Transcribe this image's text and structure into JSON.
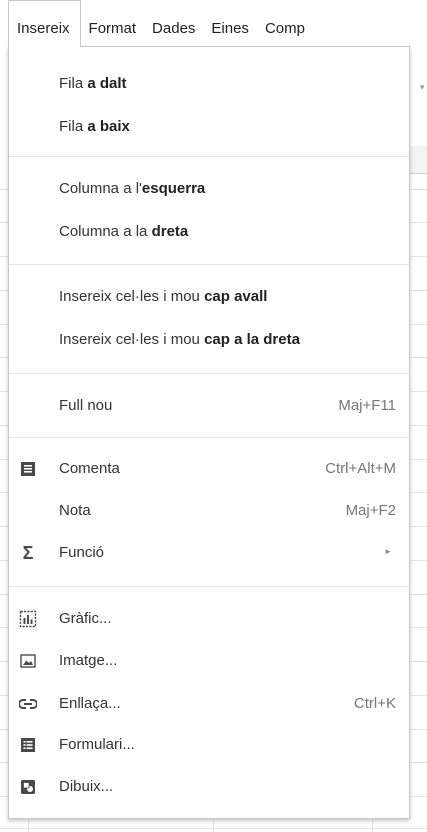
{
  "menubar": {
    "items": [
      {
        "label": "Insereix"
      },
      {
        "label": "Format"
      },
      {
        "label": "Dades"
      },
      {
        "label": "Eines"
      },
      {
        "label": "Comp"
      }
    ]
  },
  "dropdown": {
    "row_above": {
      "pre": "Fila ",
      "bold": "a dalt"
    },
    "row_below": {
      "pre": "Fila ",
      "bold": "a baix"
    },
    "col_left": {
      "pre": "Columna a l'",
      "bold": "esquerra"
    },
    "col_right": {
      "pre": "Columna a la ",
      "bold": "dreta"
    },
    "cells_down": {
      "pre": "Insereix cel·les i mou ",
      "bold": "cap avall"
    },
    "cells_right": {
      "pre": "Insereix cel·les i mou ",
      "bold": "cap a la dreta"
    },
    "new_sheet": {
      "label": "Full nou",
      "shortcut": "Maj+F11"
    },
    "comment": {
      "label": "Comenta",
      "shortcut": "Ctrl+Alt+M",
      "icon": "comment-icon"
    },
    "note": {
      "label": "Nota",
      "shortcut": "Maj+F2"
    },
    "function": {
      "label": "Funció",
      "icon": "sigma-icon",
      "submenu_glyph": "►"
    },
    "chart": {
      "label": "Gràfic...",
      "icon": "chart-icon"
    },
    "image": {
      "label": "Imatge...",
      "icon": "image-icon"
    },
    "link": {
      "label": "Enllaça...",
      "shortcut": "Ctrl+K",
      "icon": "link-icon"
    },
    "form": {
      "label": "Formulari...",
      "icon": "form-icon"
    },
    "drawing": {
      "label": "Dibuix...",
      "icon": "drawing-icon"
    }
  },
  "colors": {
    "icon_fill": "#4a4a4a",
    "separator": "#e5e5e5",
    "border": "#c9c9c9"
  }
}
